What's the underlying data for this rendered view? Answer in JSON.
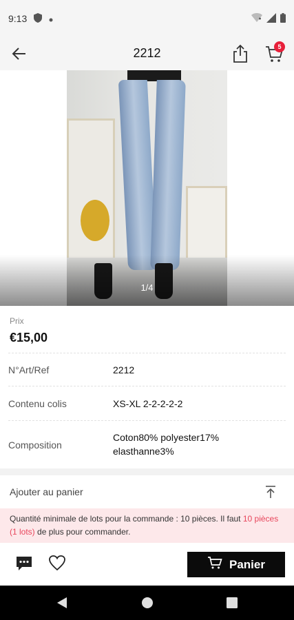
{
  "status_bar": {
    "time": "9:13"
  },
  "header": {
    "title": "2212",
    "cart_badge": "5"
  },
  "gallery": {
    "counter": "1/4"
  },
  "price": {
    "label": "Prix",
    "value": "€15,00"
  },
  "specs": [
    {
      "label": "N°Art/Ref",
      "value": "2212"
    },
    {
      "label": "Contenu colis",
      "value": "XS-XL 2-2-2-2-2"
    },
    {
      "label": "Composition",
      "value": "Coton80% polyester17% elasthanne3%"
    }
  ],
  "add_to_cart": {
    "label": "Ajouter au panier"
  },
  "notice": {
    "text_before": "Quantité minimale de lots pour la commande : 10 pièces. Il faut ",
    "highlight": "10 pièces (1 lots)",
    "text_after": " de plus pour commander."
  },
  "bottom": {
    "panier_label": "Panier"
  },
  "icons": [
    "back-arrow-icon",
    "share-icon",
    "cart-icon",
    "chat-icon",
    "heart-icon",
    "scroll-top-icon",
    "nav-back-icon",
    "nav-home-icon",
    "nav-recents-icon"
  ],
  "colors": {
    "accent": "#e8203a",
    "notice_bg": "#fde8ea",
    "notice_highlight": "#e8455b",
    "button_bg": "#0b0b0b"
  }
}
